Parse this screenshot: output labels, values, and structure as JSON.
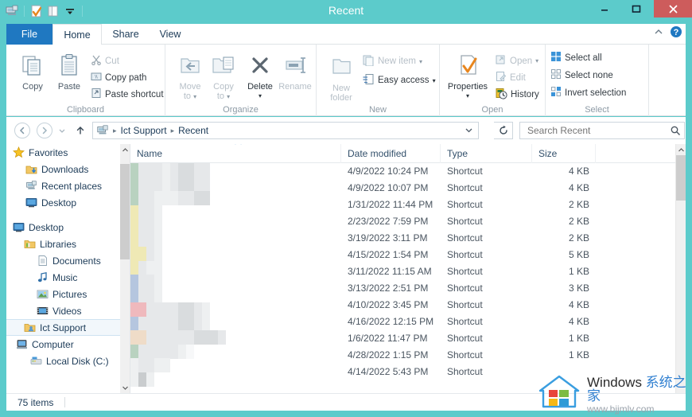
{
  "window": {
    "title": "Recent",
    "accent_color": "#5ccbcb",
    "close_color": "#cd5c5c",
    "minimize_label": "–",
    "maximize_label": "☐",
    "close_label": "✕"
  },
  "quick_access": {
    "items": [
      {
        "name": "recent-places-icon",
        "label": "Recent places"
      },
      {
        "name": "properties-icon",
        "label": "Properties"
      },
      {
        "name": "new-folder-icon",
        "label": "New folder"
      },
      {
        "name": "customize-caret-icon",
        "label": "Customize Quick Access Toolbar"
      }
    ]
  },
  "tabs": [
    {
      "id": "file",
      "label": "File"
    },
    {
      "id": "home",
      "label": "Home"
    },
    {
      "id": "share",
      "label": "Share"
    },
    {
      "id": "view",
      "label": "View"
    }
  ],
  "ribbon_controls": {
    "collapse_label": "˄",
    "help_label": "?"
  },
  "ribbon": {
    "groups": [
      {
        "id": "clipboard",
        "label": "Clipboard",
        "big_buttons": [
          {
            "name": "copy-button",
            "label": "Copy",
            "enabled": true
          },
          {
            "name": "paste-button",
            "label": "Paste",
            "enabled": true
          }
        ],
        "small_buttons": [
          {
            "name": "cut-button",
            "label": "Cut",
            "enabled": false
          },
          {
            "name": "copy-path-button",
            "label": "Copy path",
            "enabled": true
          },
          {
            "name": "paste-shortcut-button",
            "label": "Paste shortcut",
            "enabled": true
          }
        ]
      },
      {
        "id": "organize",
        "label": "Organize",
        "big_buttons": [
          {
            "name": "move-to-button",
            "label": "Move",
            "label2": "to",
            "enabled": false,
            "caret": true
          },
          {
            "name": "copy-to-button",
            "label": "Copy",
            "label2": "to",
            "enabled": false,
            "caret": true
          },
          {
            "name": "delete-button",
            "label": "Delete",
            "enabled": true,
            "caret": true
          },
          {
            "name": "rename-button",
            "label": "Rename",
            "enabled": false
          }
        ]
      },
      {
        "id": "new",
        "label": "New",
        "big_buttons": [
          {
            "name": "new-folder-button",
            "label": "New",
            "label2": "folder",
            "enabled": false
          }
        ],
        "small_buttons": [
          {
            "name": "new-item-button",
            "label": "New item",
            "enabled": false,
            "caret": true
          },
          {
            "name": "easy-access-button",
            "label": "Easy access",
            "enabled": true,
            "caret": true
          }
        ]
      },
      {
        "id": "open",
        "label": "Open",
        "big_buttons": [
          {
            "name": "properties-button",
            "label": "Properties",
            "enabled": true,
            "caret": true
          }
        ],
        "small_buttons": [
          {
            "name": "open-button",
            "label": "Open",
            "enabled": false,
            "caret": true
          },
          {
            "name": "edit-button",
            "label": "Edit",
            "enabled": false
          },
          {
            "name": "history-button",
            "label": "History",
            "enabled": true
          }
        ]
      },
      {
        "id": "select",
        "label": "Select",
        "small_buttons": [
          {
            "name": "select-all-button",
            "label": "Select all",
            "enabled": true
          },
          {
            "name": "select-none-button",
            "label": "Select none",
            "enabled": true
          },
          {
            "name": "invert-selection-button",
            "label": "Invert selection",
            "enabled": true
          }
        ]
      }
    ]
  },
  "address_bar": {
    "back_label": "←",
    "forward_label": "→",
    "history_label": "▾",
    "up_label": "↑",
    "breadcrumb_icon": "recent-places-icon",
    "breadcrumbs": [
      "Ict Support",
      "Recent"
    ],
    "separator": "▸",
    "dropdown_label": "∨",
    "refresh_label": "↻"
  },
  "search": {
    "value": "",
    "placeholder": "Search Recent",
    "icon_label": "⚲"
  },
  "nav_pane": {
    "items": [
      {
        "name": "sidebar-item-favorites",
        "label": "Favorites",
        "icon": "star-icon",
        "indent": 8,
        "selected": false
      },
      {
        "name": "sidebar-item-downloads",
        "label": "Downloads",
        "icon": "downloads-icon",
        "indent": 24,
        "selected": false
      },
      {
        "name": "sidebar-item-recent-places",
        "label": "Recent places",
        "icon": "recent-places-icon",
        "indent": 24,
        "selected": false
      },
      {
        "name": "sidebar-item-desktop-fav",
        "label": "Desktop",
        "icon": "desktop-icon",
        "indent": 24,
        "selected": false
      },
      {
        "name": "sidebar-spacer",
        "label": "",
        "icon": "",
        "indent": 0,
        "spacer": true,
        "selected": false
      },
      {
        "name": "sidebar-item-desktop",
        "label": "Desktop",
        "icon": "desktop-icon",
        "indent": 8,
        "selected": false
      },
      {
        "name": "sidebar-item-libraries",
        "label": "Libraries",
        "icon": "libraries-icon",
        "indent": 22,
        "selected": false
      },
      {
        "name": "sidebar-item-documents",
        "label": "Documents",
        "icon": "documents-icon",
        "indent": 38,
        "selected": false
      },
      {
        "name": "sidebar-item-music",
        "label": "Music",
        "icon": "music-icon",
        "indent": 38,
        "selected": false
      },
      {
        "name": "sidebar-item-pictures",
        "label": "Pictures",
        "icon": "pictures-icon",
        "indent": 38,
        "selected": false
      },
      {
        "name": "sidebar-item-videos",
        "label": "Videos",
        "icon": "videos-icon",
        "indent": 38,
        "selected": false
      },
      {
        "name": "sidebar-item-ict-support",
        "label": "Ict Support",
        "icon": "user-folder-icon",
        "indent": 22,
        "selected": true
      },
      {
        "name": "sidebar-item-computer",
        "label": "Computer",
        "icon": "computer-icon",
        "indent": 12,
        "selected": false
      },
      {
        "name": "sidebar-item-local-disk",
        "label": "Local Disk (C:)",
        "icon": "disk-icon",
        "indent": 30,
        "selected": false
      }
    ],
    "scroll_up_label": "˄",
    "scroll_down_label": "˅"
  },
  "file_list": {
    "columns": [
      {
        "id": "name",
        "label": "Name",
        "sorted": true,
        "sort_arrow": "▲"
      },
      {
        "id": "date",
        "label": "Date modified"
      },
      {
        "id": "type",
        "label": "Type"
      },
      {
        "id": "size",
        "label": "Size"
      }
    ],
    "rows": [
      {
        "name": "",
        "date": "4/9/2022 10:24 PM",
        "type": "Shortcut",
        "size": "4 KB"
      },
      {
        "name": "",
        "date": "4/9/2022 10:07 PM",
        "type": "Shortcut",
        "size": "4 KB"
      },
      {
        "name": "",
        "date": "1/31/2022 11:44 PM",
        "type": "Shortcut",
        "size": "2 KB"
      },
      {
        "name": "",
        "date": "2/23/2022 7:59 PM",
        "type": "Shortcut",
        "size": "2 KB"
      },
      {
        "name": "",
        "date": "3/19/2022 3:11 PM",
        "type": "Shortcut",
        "size": "2 KB"
      },
      {
        "name": "",
        "date": "4/15/2022 1:54 PM",
        "type": "Shortcut",
        "size": "5 KB"
      },
      {
        "name": "",
        "date": "3/11/2022 11:15 AM",
        "type": "Shortcut",
        "size": "1 KB"
      },
      {
        "name": "",
        "date": "3/13/2022 2:51 PM",
        "type": "Shortcut",
        "size": "3 KB"
      },
      {
        "name": "",
        "date": "4/10/2022 3:45 PM",
        "type": "Shortcut",
        "size": "4 KB"
      },
      {
        "name": "",
        "date": "4/16/2022 12:15 PM",
        "type": "Shortcut",
        "size": "4 KB"
      },
      {
        "name": "",
        "date": "1/6/2022 11:47 PM",
        "type": "Shortcut",
        "size": "1 KB"
      },
      {
        "name": "",
        "date": "4/28/2022 1:15 PM",
        "type": "Shortcut",
        "size": "1 KB"
      },
      {
        "name": "",
        "date": "4/14/2022 5:43 PM",
        "type": "Shortcut",
        "size": ""
      }
    ]
  },
  "status_bar": {
    "item_count": "75 items"
  },
  "watermark": {
    "brand": "Windows ",
    "brand_cn": "系统之家",
    "url": "www.bjjmlv.com"
  }
}
